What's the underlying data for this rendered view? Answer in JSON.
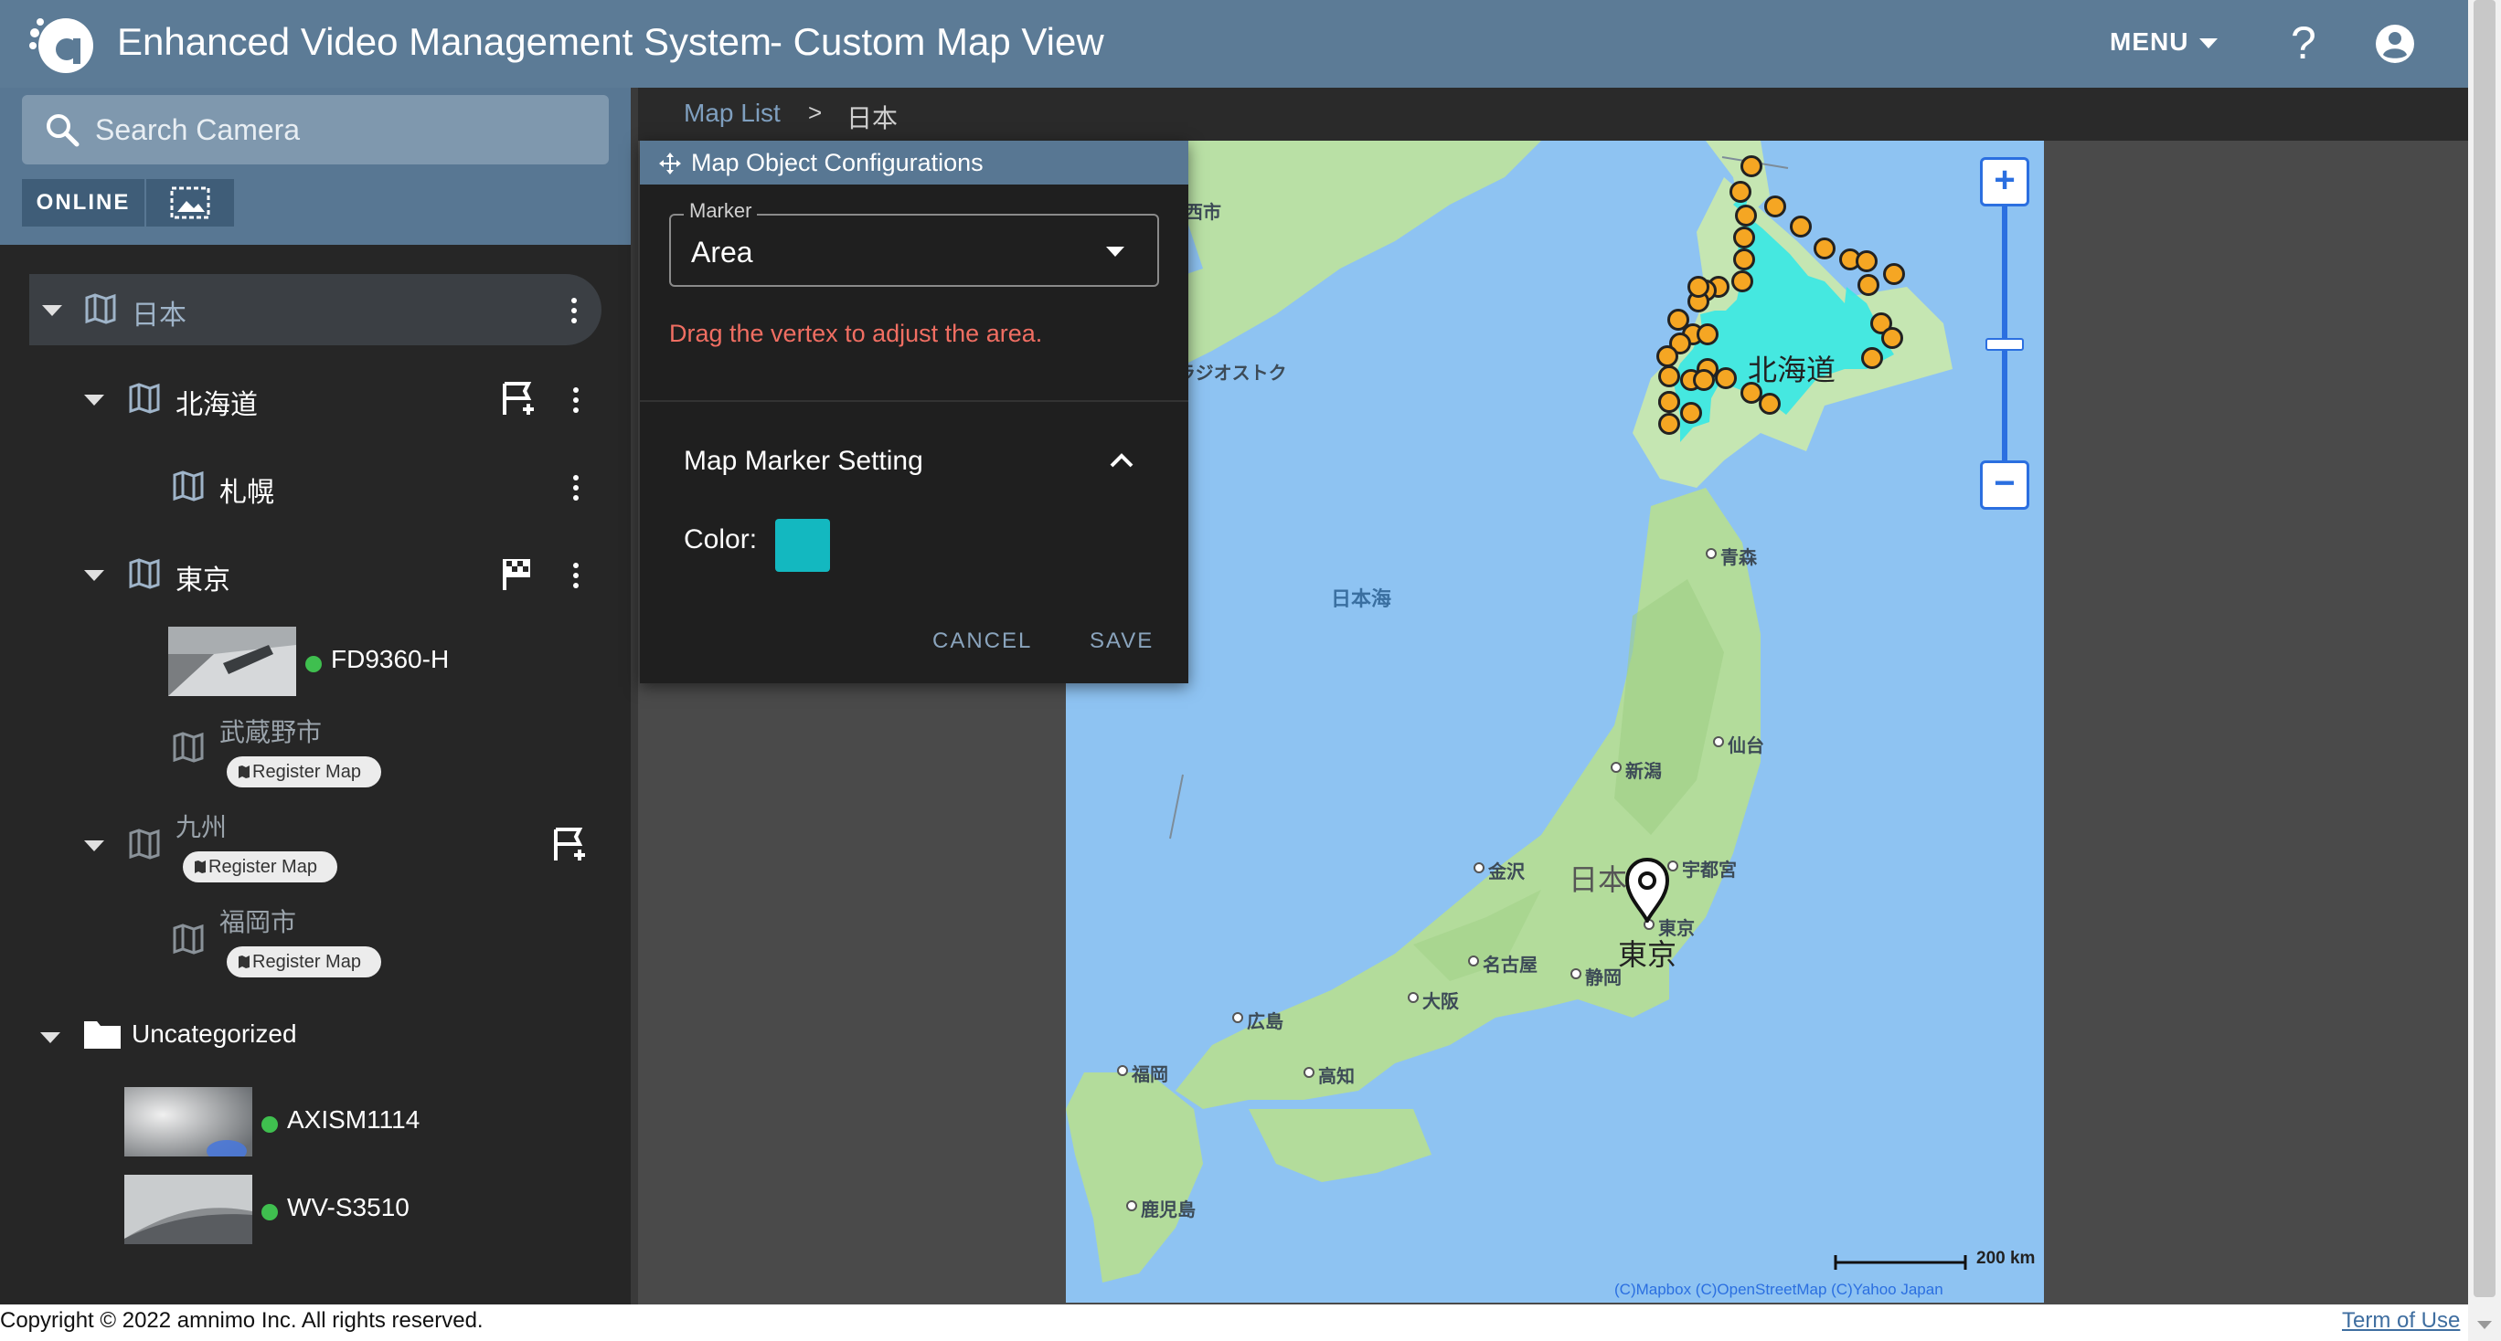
{
  "header": {
    "app_title": "Enhanced Video Management System",
    "view_title": "- Custom Map View",
    "menu_label": "MENU",
    "help_label": "?",
    "brand_color": "#5c7b96"
  },
  "sidebar": {
    "search_placeholder": "Search Camera",
    "online_label": "ONLINE",
    "tree": {
      "root": "日本",
      "hokkaido": "北海道",
      "sapporo": "札幌",
      "tokyo": "東京",
      "camera_fd": "FD9360-H",
      "musashino": "武蔵野市",
      "kyushu": "九州",
      "fukuoka": "福岡市",
      "uncategorized": "Uncategorized",
      "camera_axis": "AXISM1114",
      "camera_wv": "WV-S3510"
    },
    "register_map_label": "Register Map"
  },
  "breadcrumb": {
    "link": "Map List",
    "separator": ">",
    "current": "日本"
  },
  "dialog": {
    "title": "Map Object Configurations",
    "marker_legend": "Marker",
    "marker_value": "Area",
    "hint": "Drag the vertex to adjust the area.",
    "section_title": "Map Marker Setting",
    "color_label": "Color:",
    "color_value": "#13b8c0",
    "cancel_label": "CANCEL",
    "save_label": "SAVE"
  },
  "map": {
    "area_label": "北海道",
    "pin_label": "東京",
    "country_label": "日本",
    "sea_label": "日本海",
    "cities": {
      "vladivostok": "ウラジオストク",
      "aomori": "青森",
      "sendai": "仙台",
      "niigata": "新潟",
      "utsunomiya": "宇都宮",
      "kanazawa": "金沢",
      "tokyo": "東京",
      "nagoya": "名古屋",
      "shizuoka": "静岡",
      "osaka": "大阪",
      "hiroshima": "広島",
      "kochi": "高知",
      "fukuoka": "福岡",
      "kagoshima": "鹿児島",
      "nishi": "西市"
    },
    "zoom_in_label": "+",
    "zoom_out_label": "−",
    "scale_label": "200 km",
    "attribution": "(C)Mapbox (C)OpenStreetMap (C)Yahoo Japan",
    "area_color": "#3ae8e4"
  },
  "footer": {
    "copyright": "Copyright © 2022 amnimo Inc. All rights reserved.",
    "terms": "Term of Use"
  }
}
